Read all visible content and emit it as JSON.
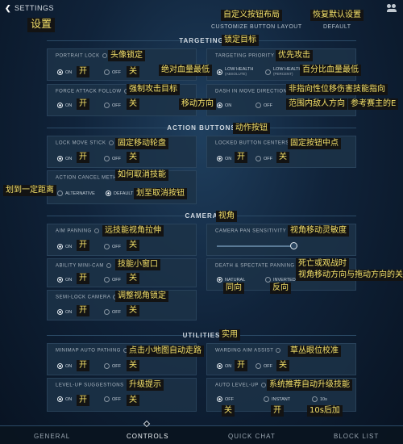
{
  "header": {
    "back_label": "SETTINGS",
    "back_icon": "chevron-left-icon",
    "customize_label": "CUSTOMIZE BUTTON LAYOUT",
    "default_label": "DEFAULT",
    "friends_icon": "friends-icon"
  },
  "sections": {
    "targeting": "TARGETING",
    "action_buttons": "ACTION BUTTONS",
    "camera": "CAMERA",
    "utilities": "UTILITIES"
  },
  "settings": {
    "portrait_lock": {
      "label": "PORTRAIT LOCK",
      "on": "ON",
      "off": "OFF",
      "selected": "ON"
    },
    "targeting_priority": {
      "label": "TARGETING PRIORITY",
      "opt1": "LOW HEALTH",
      "opt1_sub": "(ABSOLUTE)",
      "opt2": "LOW HEALTH",
      "opt2_sub": "(PERCENT)",
      "selected": "LOW HEALTH (ABSOLUTE)"
    },
    "force_attack_follow": {
      "label": "FORCE ATTACK FOLLOW",
      "on": "ON",
      "off": "OFF",
      "selected": "ON"
    },
    "dash_move_direction": {
      "label": "DASH IN MOVE DIRECTION",
      "on": "ON",
      "off": "OFF",
      "selected": "ON"
    },
    "lock_move_stick": {
      "label": "LOCK MOVE STICK",
      "on": "ON",
      "off": "OFF",
      "selected": "ON"
    },
    "locked_button_centers": {
      "label": "LOCKED BUTTON CENTERS",
      "on": "ON",
      "off": "OFF",
      "selected": "ON"
    },
    "action_cancel_method": {
      "label": "ACTION CANCEL METHOD",
      "opt1": "ALTERNATIVE",
      "opt2": "DEFAULT",
      "selected": "DEFAULT"
    },
    "aim_panning": {
      "label": "AIM PANNING",
      "on": "ON",
      "off": "OFF",
      "selected": "ON"
    },
    "camera_pan_sensitivity": {
      "label": "CAMERA PAN SENSITIVITY",
      "value": 0.95
    },
    "ability_mini_cam": {
      "label": "ABILITY MINI-CAM",
      "on": "ON",
      "off": "OFF",
      "selected": "ON"
    },
    "death_spectate_panning": {
      "label": "DEATH & SPECTATE PANNING",
      "opt1": "NATURAL",
      "opt2": "INVERTED",
      "selected": "NATURAL"
    },
    "semi_lock_camera": {
      "label": "SEMI-LOCK CAMERA",
      "on": "ON",
      "off": "OFF",
      "selected": "ON"
    },
    "minimap_auto_pathing": {
      "label": "MINIMAP AUTO PATHING",
      "on": "ON",
      "off": "OFF",
      "selected": "ON"
    },
    "warding_aim_assist": {
      "label": "WARDING AIM ASSIST",
      "on": "ON",
      "off": "OFF",
      "selected": "ON"
    },
    "level_up_suggestions": {
      "label": "LEVEL-UP SUGGESTIONS",
      "on": "ON",
      "off": "OFF",
      "selected": "ON"
    },
    "auto_level_up": {
      "label": "AUTO LEVEL-UP",
      "opt1": "OFF",
      "opt2": "INSTANT",
      "opt3": "10s",
      "selected": "OFF"
    }
  },
  "annotations": {
    "settings": "设置",
    "customize": "自定义按钮布局",
    "default": "恢复默认设置",
    "targeting": "锁定目标",
    "portrait_lock": "头像锁定",
    "targeting_priority": "优先攻击",
    "low_abs": "绝对血量最低",
    "low_pct": "百分比血量最低",
    "on1": "开",
    "off1": "关",
    "force_follow": "强制攻击目标",
    "move_dir": "移动方向",
    "dash_dir": "非指向性位移伤害技能指向",
    "dash_dir2": "范围内敌人方向",
    "dash_dir3": "参考赛主的E",
    "on2": "开",
    "off2": "关",
    "action_buttons": "动作按钮",
    "lock_stick": "固定移动轮盘",
    "lock_center": "固定按钮中点",
    "on3": "开",
    "off3": "关",
    "on4": "开",
    "off4": "关",
    "cancel_method": "如何取消技能",
    "drag_away": "划到一定距离",
    "drag_cancel": "划至取消按钮",
    "camera": "视角",
    "aim_panning": "远技能视角拉伸",
    "pan_sens": "视角移动灵敏度",
    "on5": "开",
    "off5": "关",
    "mini_cam": "技能小窗口",
    "death_pan": "死亡或观战时",
    "death_pan2": "视角移动方向与拖动方向的关系",
    "same_dir": "同向",
    "opp_dir": "反向",
    "on6": "开",
    "off6": "关",
    "semi_lock": "调整视角锁定",
    "on7": "开",
    "off7": "关",
    "utilities": "实用",
    "minimap_path": "点击小地图自动走路",
    "ward_assist": "草丛眼位校准",
    "on8": "开",
    "off8": "关",
    "on9": "开",
    "off9": "关",
    "level_sugg": "升级提示",
    "auto_level": "系统推荐自动升级技能",
    "on10": "开",
    "off10": "关",
    "al_off": "关",
    "al_on": "开",
    "al_delay": "10s后加"
  },
  "tabs": {
    "general": "GENERAL",
    "controls": "CONTROLS",
    "quick_chat": "QUICK CHAT",
    "block_list": "BLOCK LIST"
  }
}
